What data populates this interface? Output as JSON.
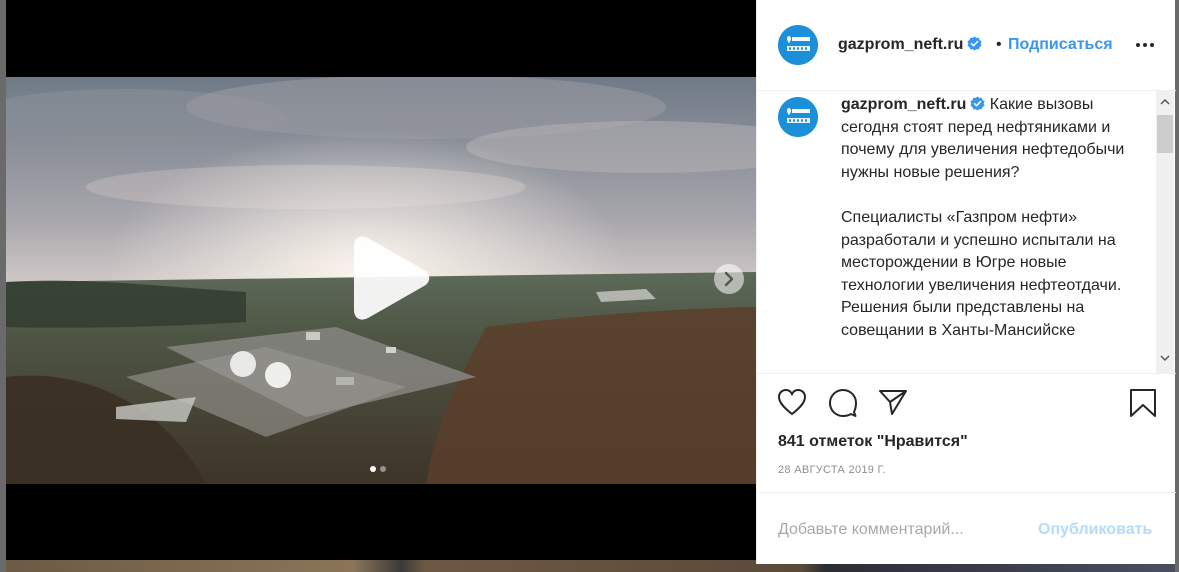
{
  "post": {
    "username": "gazprom_neft.ru",
    "separator": "•",
    "follow_label": "Подписаться",
    "more_icon": "more-horizontal-icon",
    "verified_icon": "verified-badge-icon",
    "avatar_logo": "gazprom-neft-logo",
    "caption_paragraphs": [
      "Какие вызовы сегодня стоят перед нефтяниками и почему для увеличения нефтедобычи нужны новые решения?",
      "Специалисты «Газпром нефти» разработали и успешно испытали на месторождении в Югре новые технологии увеличения нефтеотдачи. Решения были представлены на совещании в Ханты-Мансийске"
    ],
    "likes_text": "841 отметок \"Нравится\"",
    "date_text": "28 АВГУСТА 2019 Г.",
    "comment_placeholder": "Добавьте комментарий...",
    "publish_label": "Опубликовать"
  },
  "media": {
    "type": "video",
    "carousel_count": 2,
    "carousel_active": 1,
    "play_icon": "play-icon",
    "next_icon": "chevron-right-icon"
  },
  "actions": {
    "like_icon": "heart-icon",
    "comment_icon": "comment-icon",
    "share_icon": "share-icon",
    "save_icon": "bookmark-icon"
  },
  "colors": {
    "link_blue": "#3897f0",
    "publish_disabled": "#b3dbff",
    "avatar_bg": "#1b8fd8",
    "text": "#262626",
    "muted": "#8e8e8e"
  }
}
